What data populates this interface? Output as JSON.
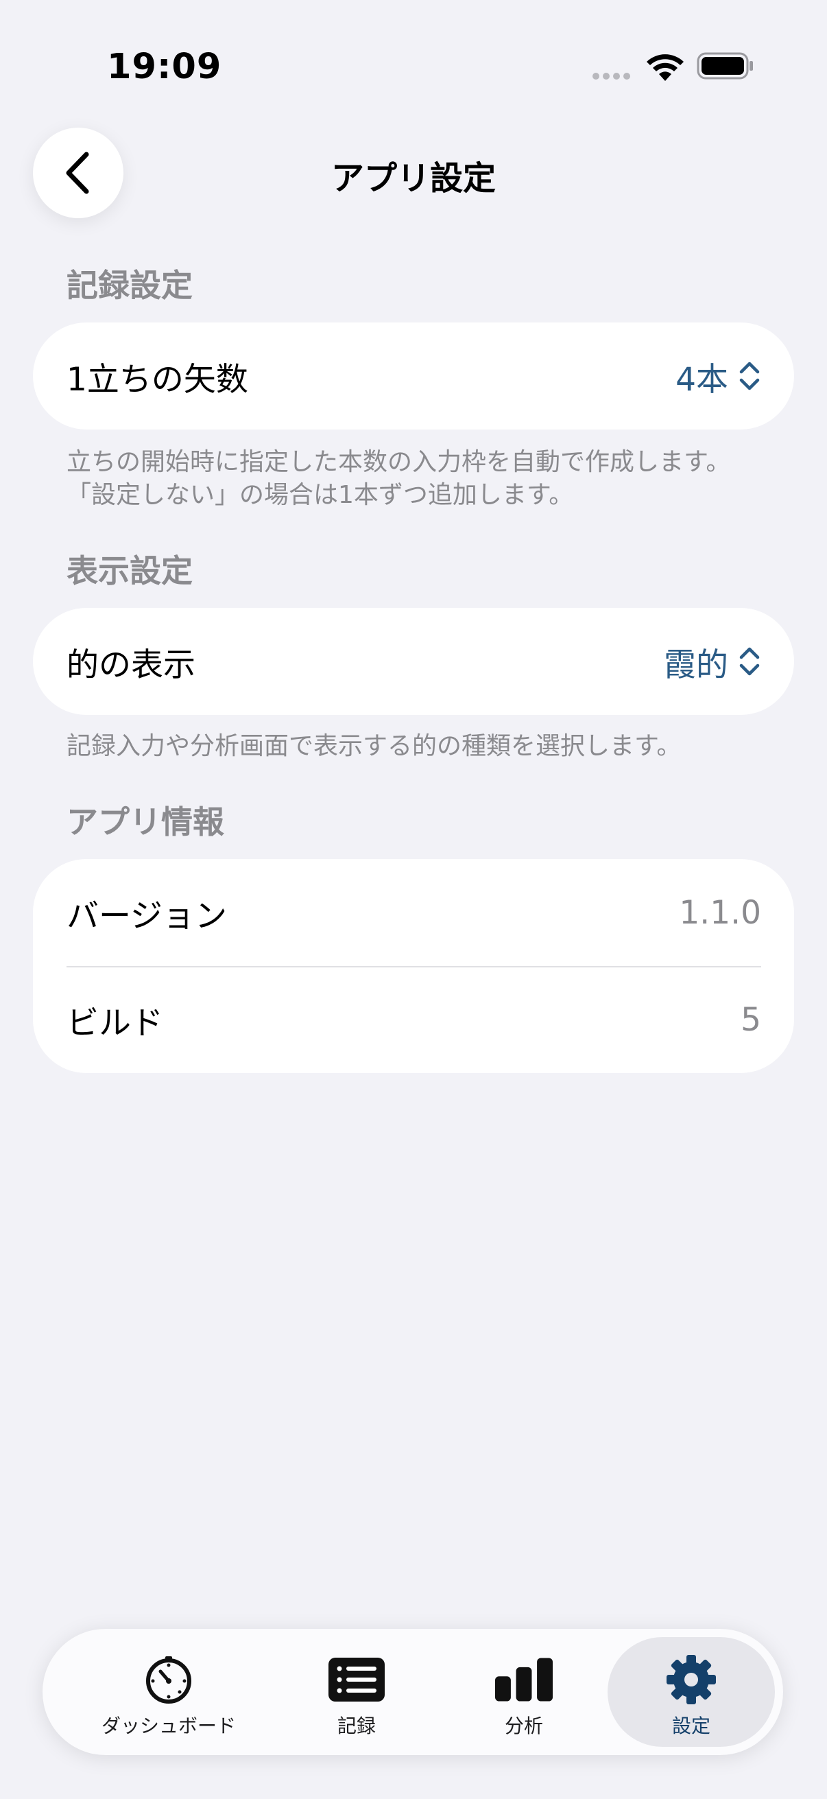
{
  "status_bar": {
    "time": "19:09"
  },
  "header": {
    "title": "アプリ設定"
  },
  "sections": {
    "record": {
      "title": "記録設定",
      "row_label": "1立ちの矢数",
      "row_value": "4本",
      "note_line1": "立ちの開始時に指定した本数の入力枠を自動で作成します。",
      "note_line2": "「設定しない」の場合は1本ずつ追加します。"
    },
    "display": {
      "title": "表示設定",
      "row_label": "的の表示",
      "row_value": "霞的",
      "note": "記録入力や分析画面で表示する的の種類を選択します。"
    },
    "app_info": {
      "title": "アプリ情報",
      "version_label": "バージョン",
      "version_value": "1.1.0",
      "build_label": "ビルド",
      "build_value": "5"
    }
  },
  "tab_bar": {
    "tabs": [
      {
        "label": "ダッシュボード",
        "icon": "stopwatch-icon"
      },
      {
        "label": "記録",
        "icon": "list-icon"
      },
      {
        "label": "分析",
        "icon": "bar-chart-icon"
      },
      {
        "label": "設定",
        "icon": "gear-icon",
        "active": true
      }
    ]
  },
  "colors": {
    "accent": "#2a5b86",
    "active_tab": "#14406a",
    "background": "#f2f2f7",
    "secondary_text": "#8a8a8e"
  }
}
